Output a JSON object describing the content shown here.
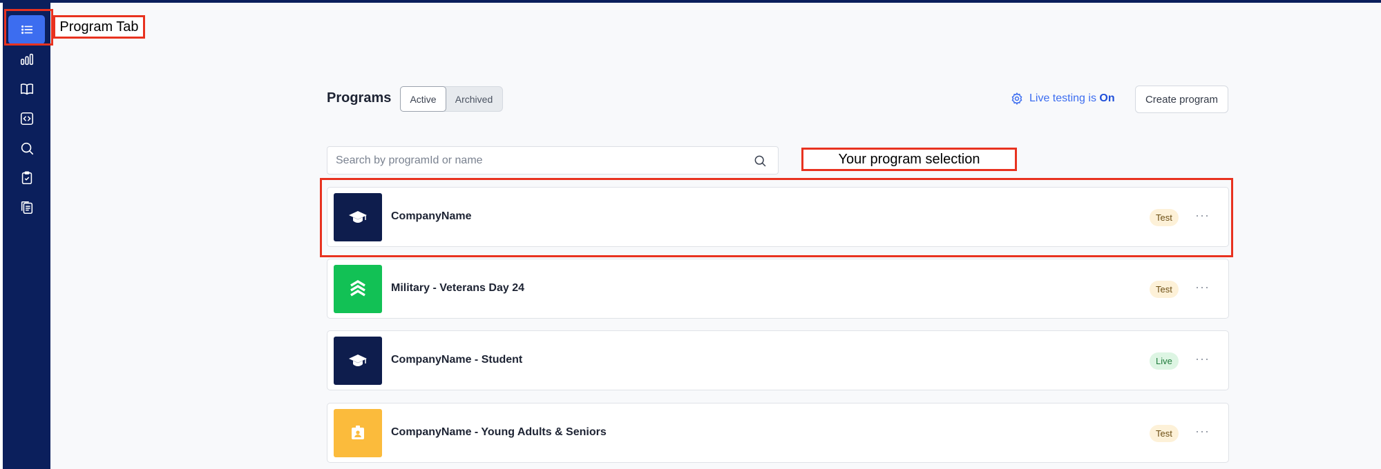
{
  "annotations": {
    "program_tab": "Program Tab",
    "selection": "Your program selection"
  },
  "sidebar": {
    "items": [
      {
        "icon": "list-icon",
        "active": true
      },
      {
        "icon": "bar-chart-icon",
        "active": false
      },
      {
        "icon": "book-icon",
        "active": false
      },
      {
        "icon": "code-icon",
        "active": false
      },
      {
        "icon": "search-icon",
        "active": false
      },
      {
        "icon": "clipboard-check-icon",
        "active": false
      },
      {
        "icon": "clipboard-copy-icon",
        "active": false
      }
    ]
  },
  "header": {
    "title": "Programs",
    "tabs": [
      {
        "label": "Active",
        "selected": true
      },
      {
        "label": "Archived",
        "selected": false
      }
    ],
    "live_testing_prefix": "Live testing is",
    "live_testing_state": "On",
    "create_label": "Create program"
  },
  "search": {
    "placeholder": "Search by programId or name"
  },
  "programs": [
    {
      "name": "CompanyName",
      "status": "Test",
      "logo_color": "#0e1d4d",
      "icon": "graduation-cap-icon"
    },
    {
      "name": "Military - Veterans Day 24",
      "status": "Test",
      "logo_color": "#12c155",
      "icon": "chevron-rank-icon"
    },
    {
      "name": "CompanyName - Student",
      "status": "Live",
      "logo_color": "#0e1d4d",
      "icon": "graduation-cap-icon"
    },
    {
      "name": "CompanyName - Young Adults & Seniors",
      "status": "Test",
      "logo_color": "#fbbb3c",
      "icon": "id-badge-icon"
    }
  ],
  "more_label": "···",
  "colors": {
    "sidebar": "#0b1f5c",
    "accent": "#3c6df0",
    "annotation": "#e8321f"
  }
}
